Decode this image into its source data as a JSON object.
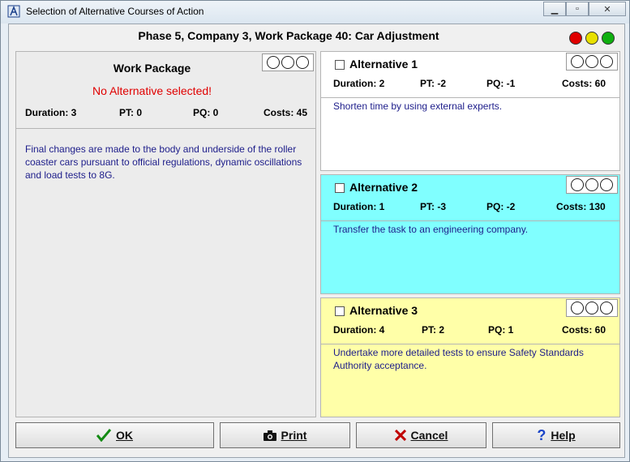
{
  "window": {
    "title": "Selection of Alternative Courses of Action"
  },
  "header": {
    "title": "Phase 5, Company 3, Work Package 40: Car Adjustment"
  },
  "status_lights": [
    "#e00000",
    "#e8e000",
    "#10b010"
  ],
  "work_package": {
    "title": "Work Package",
    "status": "No Alternative selected!",
    "duration": "Duration: 3",
    "pt": "PT: 0",
    "pq": "PQ: 0",
    "costs": "Costs: 45",
    "description": "Final changes are made to the body and underside of the roller coaster cars pursuant to official regulations, dynamic oscillations and load tests to 8G."
  },
  "alternatives": [
    {
      "title": "Alternative 1",
      "duration": "Duration: 2",
      "pt": "PT: -2",
      "pq": "PQ: -1",
      "costs": "Costs: 60",
      "description": "Shorten time by using external experts.",
      "color": "#ffffff"
    },
    {
      "title": "Alternative 2",
      "duration": "Duration: 1",
      "pt": "PT: -3",
      "pq": "PQ: -2",
      "costs": "Costs: 130",
      "description": "Transfer the task to an engineering company.",
      "color": "#80ffff"
    },
    {
      "title": "Alternative 3",
      "duration": "Duration: 4",
      "pt": "PT: 2",
      "pq": "PQ: 1",
      "costs": "Costs: 60",
      "description": "Undertake more detailed tests to ensure Safety Standards Authority acceptance.",
      "color": "#ffffa8"
    }
  ],
  "buttons": {
    "ok": "OK",
    "print": "Print",
    "cancel": "Cancel",
    "help": "Help"
  },
  "icons": {
    "ok": "checkmark-icon",
    "print": "camera-icon",
    "cancel": "x-icon",
    "help": "question-icon"
  }
}
